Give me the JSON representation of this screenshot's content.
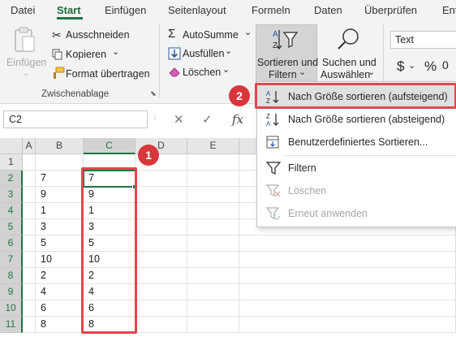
{
  "ribbon_tabs": [
    "Datei",
    "Start",
    "Einfügen",
    "Seitenlayout",
    "Formeln",
    "Daten",
    "Überprüfen",
    "Ent"
  ],
  "clipboard": {
    "paste": "Einfügen",
    "cut": "Ausschneiden",
    "copy": "Kopieren",
    "format_painter": "Format übertragen",
    "group_label": "Zwischenablage"
  },
  "editing": {
    "autosum": "AutoSumme",
    "fill": "Ausfüllen",
    "clear": "Löschen",
    "sort_filter_line1": "Sortieren und",
    "sort_filter_line2": "Filtern",
    "find_select_line1": "Suchen und",
    "find_select_line2": "Auswählen"
  },
  "number": {
    "format_value": "Text",
    "currency_symbol": "$",
    "percent_symbol": "%"
  },
  "formula_bar": {
    "name_box": "C2",
    "fx": "fx"
  },
  "sheet": {
    "columns": [
      "A",
      "B",
      "C",
      "D",
      "E"
    ],
    "rows": [
      "1",
      "2",
      "3",
      "4",
      "5",
      "6",
      "7",
      "8",
      "9",
      "10",
      "11"
    ],
    "col_b": [
      "",
      "7",
      "9",
      "1",
      "3",
      "5",
      "10",
      "2",
      "4",
      "6",
      "8"
    ],
    "col_c": [
      "",
      "7",
      "9",
      "1",
      "3",
      "5",
      "10",
      "2",
      "4",
      "6",
      "8"
    ]
  },
  "sort_menu": {
    "items": [
      "Nach Größe sortieren (aufsteigend)",
      "Nach Größe sortieren (absteigend)",
      "Benutzerdefiniertes Sortieren...",
      "Filtern",
      "Löschen",
      "Erneut anwenden"
    ]
  },
  "badges": [
    "1",
    "2"
  ],
  "colors": {
    "accent": "#217346",
    "highlight_red": "#e0474c",
    "badge_red": "#d9363b"
  }
}
